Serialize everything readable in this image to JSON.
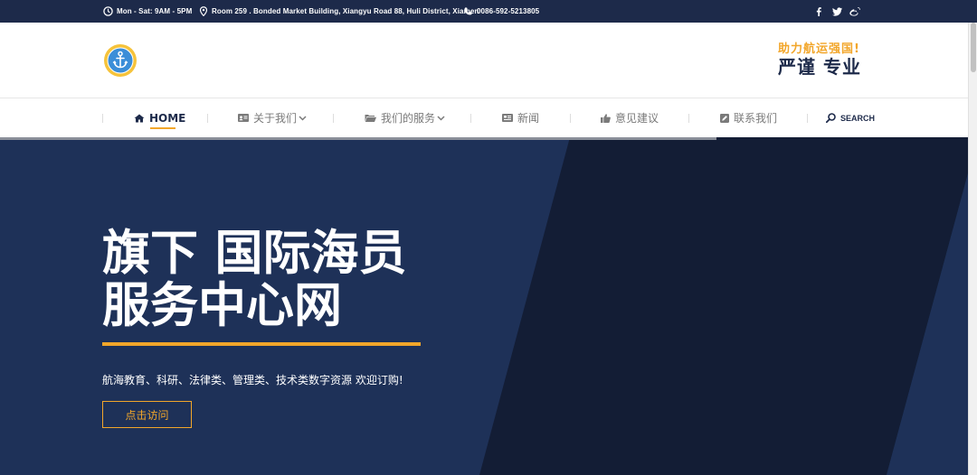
{
  "topbar": {
    "hours": "Mon - Sat: 9AM - 5PM",
    "address": "Room 259 . Bonded Market Building, Xiangyu Road 88, Huli District, Xiamen",
    "phone": "0086-592-5213805",
    "social": [
      "facebook-icon",
      "twitter-icon",
      "weibo-icon"
    ]
  },
  "header": {
    "logo": "anchor-logo",
    "slogan_top": "助力航运强国!",
    "slogan_bottom": "严谨 专业"
  },
  "nav": {
    "items": [
      {
        "label": "HOME",
        "icon": "home-icon",
        "active": true
      },
      {
        "label": "关于我们",
        "icon": "id-card-icon",
        "dropdown": true
      },
      {
        "label": "我们的服务",
        "icon": "folder-icon",
        "dropdown": true
      },
      {
        "label": "新闻",
        "icon": "newspaper-icon"
      },
      {
        "label": "意见建议",
        "icon": "thumbs-up-icon"
      },
      {
        "label": "联系我们",
        "icon": "edit-icon"
      }
    ],
    "search_label": "SEARCH"
  },
  "hero": {
    "title_line1": "旗下 国际海员",
    "title_line2": "服务中心网",
    "subtitle": "航海教育、科研、法律类、管理类、技术类数字资源 欢迎订购!",
    "button_label": "点击访问"
  },
  "colors": {
    "navy": "#1d2a4a",
    "hero_bg": "#1e3158",
    "hero_dark": "#131d35",
    "accent": "#f2a62a"
  }
}
